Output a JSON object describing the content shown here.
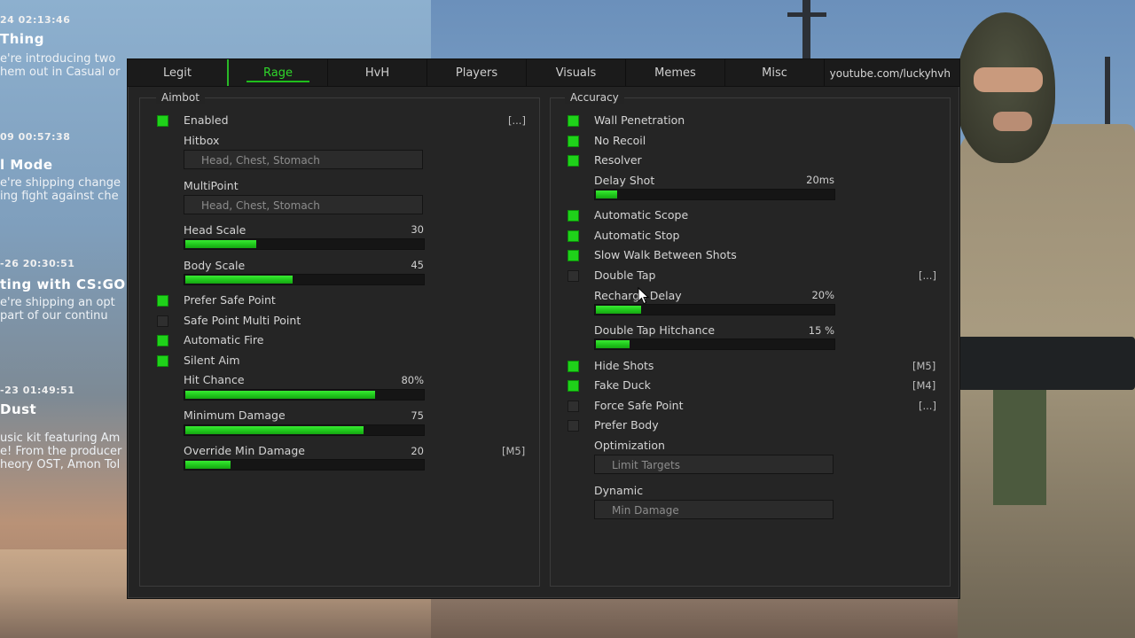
{
  "background": {
    "news": [
      {
        "date": "24 02:13:46",
        "title": "Thing",
        "lines": [
          "e're introducing two",
          "hem out in Casual or"
        ]
      },
      {
        "date": "09 00:57:38",
        "title": "l Mode",
        "lines": [
          "e're shipping change",
          "ing fight against che"
        ]
      },
      {
        "date": "-26 20:30:51",
        "title": "ting with CS:GO",
        "lines": [
          "e're shipping an opt",
          "part of our continu"
        ]
      },
      {
        "date": "-23 01:49:51",
        "title": "Dust",
        "lines": [
          "usic kit featuring Am",
          "e! From the producer",
          "heory OST, Amon Tol"
        ]
      }
    ]
  },
  "menu": {
    "tabs": [
      "Legit",
      "Rage",
      "HvH",
      "Players",
      "Visuals",
      "Memes",
      "Misc"
    ],
    "active_tab": "Rage",
    "site": "youtube.com/luckyhvh",
    "accent_color": "#1fd21a",
    "aimbot": {
      "title": "Aimbot",
      "enabled": {
        "label": "Enabled",
        "on": true,
        "key": "[...]"
      },
      "hitbox": {
        "label": "Hitbox",
        "value": "Head, Chest, Stomach"
      },
      "multipoint": {
        "label": "MultiPoint",
        "value": "Head, Chest, Stomach"
      },
      "head_scale": {
        "label": "Head Scale",
        "value": "30",
        "fraction": 0.3
      },
      "body_scale": {
        "label": "Body Scale",
        "value": "45",
        "fraction": 0.45
      },
      "prefer_safe_point": {
        "label": "Prefer Safe Point",
        "on": true
      },
      "safe_point_multi_point": {
        "label": "Safe Point Multi Point",
        "on": false
      },
      "automatic_fire": {
        "label": "Automatic Fire",
        "on": true
      },
      "silent_aim": {
        "label": "Silent Aim",
        "on": true
      },
      "hit_chance": {
        "label": "Hit Chance",
        "value": "80%",
        "fraction": 0.8
      },
      "minimum_damage": {
        "label": "Minimum Damage",
        "value": "75",
        "fraction": 0.75
      },
      "override_min_damage": {
        "label": "Override Min Damage",
        "value": "20",
        "fraction": 0.19,
        "key": "[M5]"
      }
    },
    "accuracy": {
      "title": "Accuracy",
      "wall_penetration": {
        "label": "Wall Penetration",
        "on": true
      },
      "no_recoil": {
        "label": "No Recoil",
        "on": true
      },
      "resolver": {
        "label": "Resolver",
        "on": true
      },
      "delay_shot": {
        "label": "Delay Shot",
        "value": "20ms",
        "fraction": 0.09
      },
      "automatic_scope": {
        "label": "Automatic Scope",
        "on": true
      },
      "automatic_stop": {
        "label": "Automatic Stop",
        "on": true
      },
      "slow_walk": {
        "label": "Slow Walk Between Shots",
        "on": true
      },
      "double_tap": {
        "label": "Double Tap",
        "on": false,
        "key": "[...]"
      },
      "recharge_delay": {
        "label": "Recharge Delay",
        "value": "20%",
        "fraction": 0.19
      },
      "double_tap_hitchance": {
        "label": "Double Tap Hitchance",
        "value": "15 %",
        "fraction": 0.14
      },
      "hide_shots": {
        "label": "Hide Shots",
        "on": true,
        "key": "[M5]"
      },
      "fake_duck": {
        "label": "Fake Duck",
        "on": true,
        "key": "[M4]"
      },
      "force_safe_point": {
        "label": "Force Safe Point",
        "on": false,
        "key": "[...]"
      },
      "prefer_body": {
        "label": "Prefer Body",
        "on": false
      },
      "optimization": {
        "label": "Optimization",
        "value": "Limit Targets"
      },
      "dynamic": {
        "label": "Dynamic",
        "value": "Min Damage"
      }
    }
  }
}
